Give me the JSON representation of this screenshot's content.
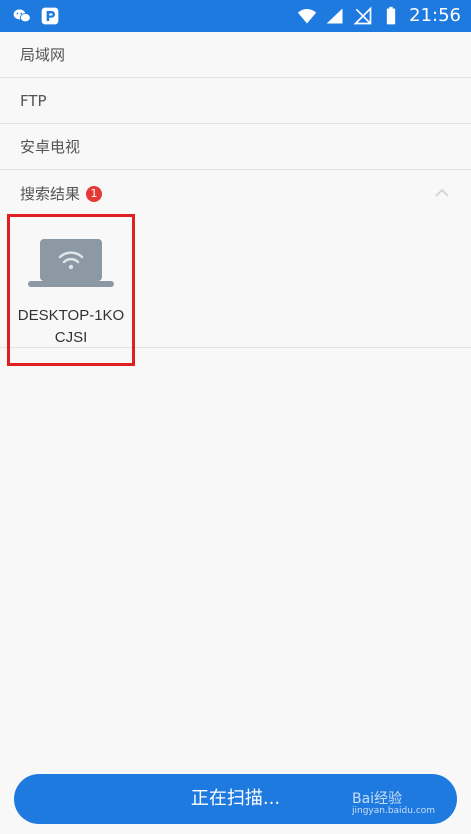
{
  "statusbar": {
    "time": "21:56",
    "icons": [
      "wechat-icon",
      "p-app-icon",
      "wifi-icon",
      "signal-icon",
      "no-sim-icon",
      "battery-icon"
    ]
  },
  "list": {
    "items": [
      {
        "label": "局域网"
      },
      {
        "label": "FTP"
      },
      {
        "label": "安卓电视"
      }
    ],
    "results": {
      "label": "搜索结果",
      "count": "1"
    }
  },
  "device": {
    "name": "DESKTOP-1KOCJSI",
    "icon": "laptop-wifi-icon"
  },
  "scan_button": {
    "label": "正在扫描..."
  },
  "watermark": {
    "text": "Bai经验",
    "sub": "jingyan.baidu.com"
  },
  "colors": {
    "primary": "#1f7ae0",
    "badge": "#e53935",
    "highlight": "#e02020"
  }
}
